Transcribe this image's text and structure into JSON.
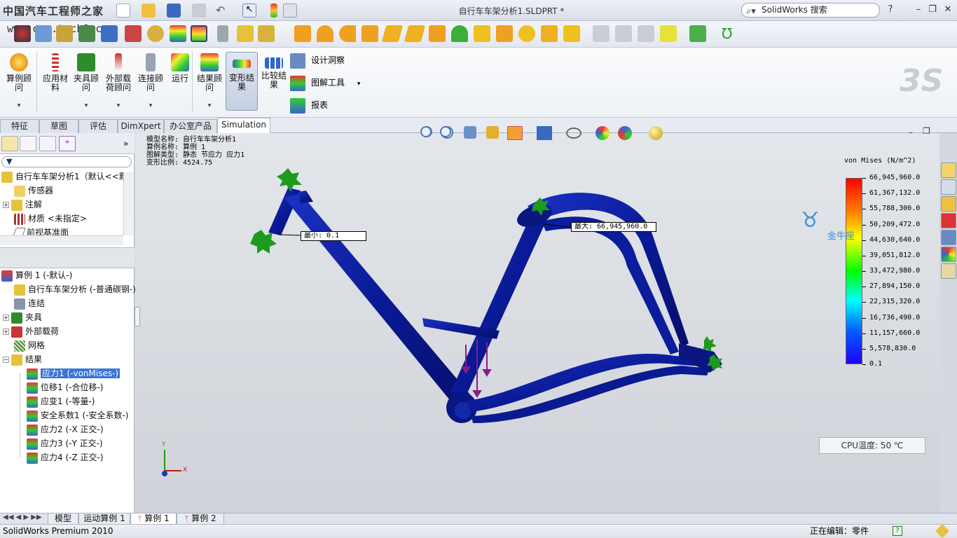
{
  "titlebar": {
    "brand_text": "中国汽车工程师之家",
    "document_title": "自行车车架分析1.SLDPRT *",
    "search_text": "SolidWorks 搜索",
    "help_label": "?"
  },
  "watermark": "www.car.tech8.com",
  "ribbon": {
    "buttons": [
      {
        "label": "算例顾问"
      },
      {
        "label": "应用材料"
      },
      {
        "label": "夹具顾问"
      },
      {
        "label": "外部载荷顾问"
      },
      {
        "label": "连接顾问"
      },
      {
        "label": "运行"
      },
      {
        "label": "结果顾问"
      },
      {
        "label": "变形结果"
      },
      {
        "label": "比较结果"
      }
    ],
    "side_items": [
      {
        "label": "设计洞察"
      },
      {
        "label": "图解工具"
      },
      {
        "label": "报表"
      }
    ]
  },
  "tabs": [
    "特征",
    "草图",
    "评估",
    "DimXpert",
    "办公室产品",
    "Simulation"
  ],
  "active_tab": "Simulation",
  "feature_tree": {
    "root": "自行车车架分析1（默认<<默",
    "items": [
      "传感器",
      "注解",
      "材质 <未指定>",
      "前视基准面"
    ]
  },
  "study_tree": {
    "root": "算例 1 (-默认-)",
    "items": [
      {
        "label": "自行车车架分析 (-普通碳钢-)"
      },
      {
        "label": "连结"
      },
      {
        "label": "夹具"
      },
      {
        "label": "外部载荷"
      },
      {
        "label": "网格"
      },
      {
        "label": "结果"
      }
    ],
    "results": [
      {
        "label": "应力1 (-vonMises-)",
        "selected": true
      },
      {
        "label": "位移1 (-合位移-)"
      },
      {
        "label": "应变1 (-等量-)"
      },
      {
        "label": "安全系数1 (-安全系数-)"
      },
      {
        "label": "应力2 (-X 正交-)"
      },
      {
        "label": "应力3 (-Y 正交-)"
      },
      {
        "label": "应力4 (-Z 正交-)"
      }
    ]
  },
  "plot_info": {
    "line1": "模型名称: 自行车车架分析1",
    "line2": "算例名称: 算例 1",
    "line3": "图解类型: 静态 节应力 应力1",
    "line4": "变形比例: 4524.75"
  },
  "legend": {
    "title": "von Mises (N/m^2)",
    "values": [
      "66,945,960.0",
      "61,367,132.0",
      "55,788,300.0",
      "50,209,472.0",
      "44,630,640.0",
      "39,051,812.0",
      "33,472,980.0",
      "27,894,150.0",
      "22,315,320.0",
      "16,736,490.0",
      "11,157,660.0",
      "5,578,830.0",
      "0.1"
    ]
  },
  "callouts": {
    "min_label": "最小:   0.1",
    "max_label": "最大:   66,945,960.0"
  },
  "taurus_text": "金牛座",
  "cpu_temp": "CPU温度: 50 ℃",
  "bottom_tabs": [
    "模型",
    "运动算例 1",
    "算例 1",
    "算例 2"
  ],
  "active_bottom_tab": "算例 1",
  "status": {
    "product": "SolidWorks Premium 2010",
    "editing": "正在编辑：零件",
    "help": "?"
  },
  "axis": {
    "x": "X",
    "y": "Y"
  },
  "colors": {
    "mesh_blue": "#0b1c9c",
    "fixture_green": "#1e9b1e",
    "load_purple": "#8a1a8c"
  }
}
